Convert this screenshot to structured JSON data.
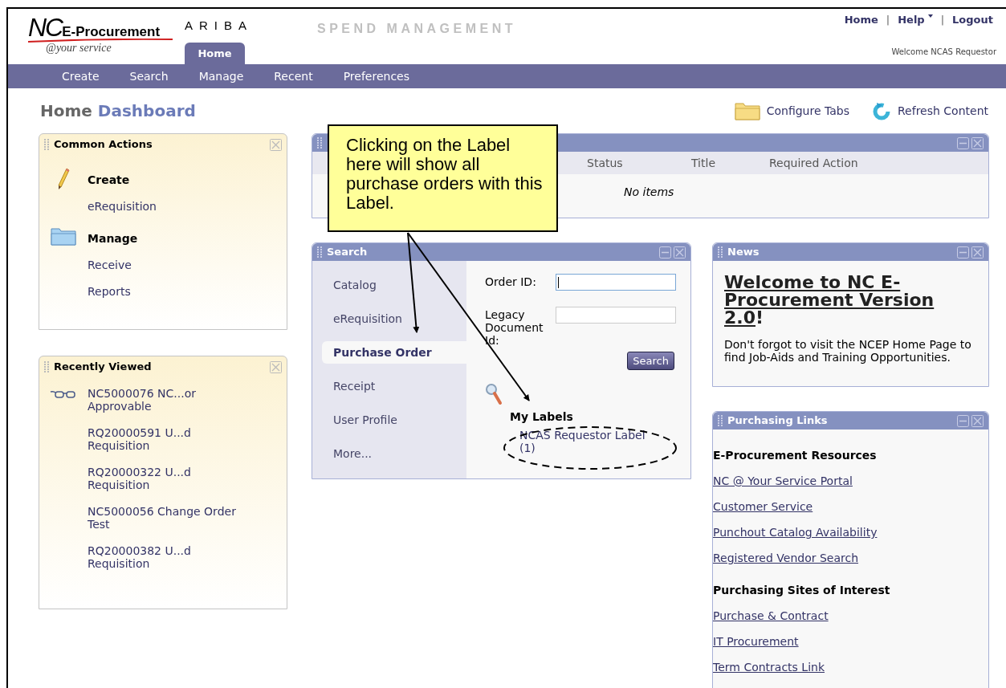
{
  "header": {
    "logo": {
      "mark": "NC",
      "product": "E-Procurement",
      "tagline": "@your service"
    },
    "vendor": "ARIBA",
    "suite": "SPEND MANAGEMENT",
    "top_links": [
      {
        "label": "Home",
        "dropdown": false
      },
      {
        "label": "Help",
        "dropdown": true
      },
      {
        "label": "Logout",
        "dropdown": false
      }
    ],
    "link_separator": "|",
    "welcome": "Welcome NCAS Requestor"
  },
  "tabs": [
    {
      "label": "Home",
      "selected": true
    }
  ],
  "nav": [
    "Create",
    "Search",
    "Manage",
    "Recent",
    "Preferences"
  ],
  "page_title": {
    "first": "Home",
    "second": "Dashboard"
  },
  "toolbar": [
    {
      "label": "Configure Tabs"
    },
    {
      "label": "Refresh Content"
    }
  ],
  "common_actions": {
    "title": "Common Actions",
    "groups": [
      {
        "heading": "Create",
        "links": [
          "eRequisition"
        ]
      },
      {
        "heading": "Manage",
        "links": [
          "Receive",
          "Reports"
        ]
      }
    ]
  },
  "recently_viewed": {
    "title": "Recently Viewed",
    "items": [
      {
        "text": "NC5000076 NC...or Approvable"
      },
      {
        "text": "RQ20000591 U...d Requisition"
      },
      {
        "text": "RQ20000322 U...d Requisition"
      },
      {
        "text": "NC5000056 Change Order Test"
      },
      {
        "text": "RQ20000382 U...d Requisition"
      }
    ]
  },
  "todo_panel": {
    "columns": [
      "Status",
      "Title",
      "Required Action"
    ],
    "empty_text": "No items"
  },
  "search_panel": {
    "title": "Search",
    "categories": [
      {
        "label": "Catalog",
        "selected": false
      },
      {
        "label": "eRequisition",
        "selected": false
      },
      {
        "label": "Purchase Order",
        "selected": true
      },
      {
        "label": "Receipt",
        "selected": false
      },
      {
        "label": "User Profile",
        "selected": false
      },
      {
        "label": "More...",
        "selected": false
      }
    ],
    "fields": [
      {
        "label": "Order ID:",
        "focused": true
      },
      {
        "label": "Legacy Document Id:",
        "focused": false
      }
    ],
    "button": "Search",
    "labels": {
      "title": "My Labels",
      "items": [
        "NCAS Requestor Label (1)"
      ]
    }
  },
  "news": {
    "title": "News",
    "headline": "Welcome to NC E-Procurement Version 2.0",
    "headline_end": "!",
    "body": "Don't forgot to visit the NCEP Home Page to find Job-Aids and Training Opportunities."
  },
  "purchasing_links": {
    "title": "Purchasing Links",
    "sections": [
      {
        "heading": "E-Procurement Resources",
        "links": [
          "NC @ Your Service Portal",
          "Customer Service",
          "Punchout Catalog Availability",
          "Registered Vendor Search"
        ]
      },
      {
        "heading": "Purchasing Sites of Interest",
        "links": [
          "Purchase & Contract",
          "IT Procurement",
          "Term Contracts Link"
        ]
      }
    ]
  },
  "callout": {
    "text": "Clicking on the Label here will show all purchase orders with this Label."
  }
}
